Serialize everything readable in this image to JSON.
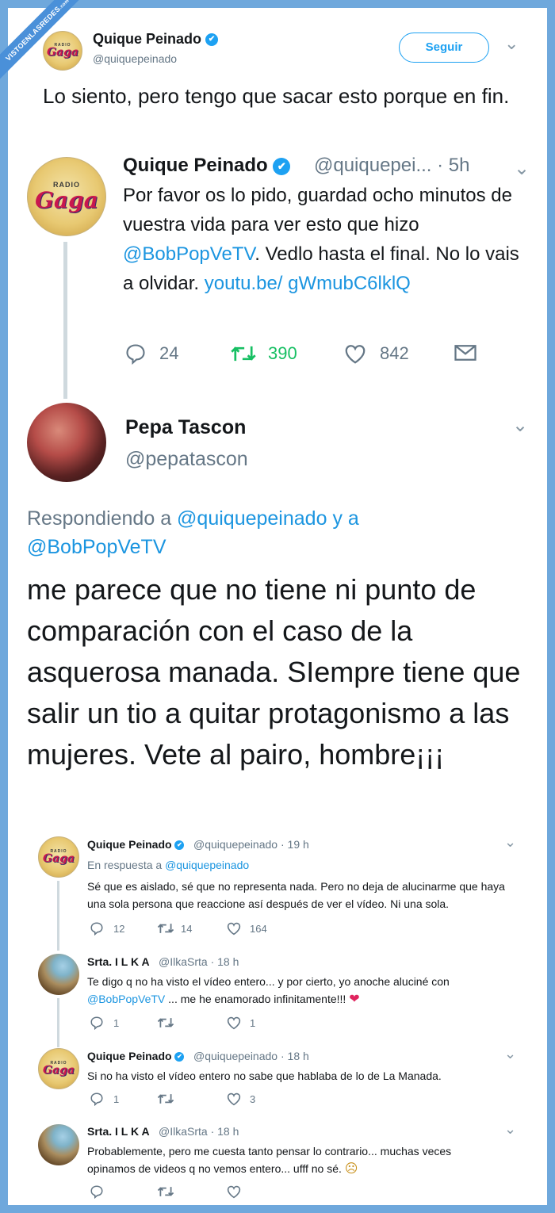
{
  "watermark": "VISTOENLASREDES",
  "watermark_suffix": ".com",
  "main_tweet": {
    "author": "Quique Peinado",
    "handle": "@quiquepeinado",
    "follow_label": "Seguir",
    "text": "Lo siento, pero tengo que sacar esto porque en fin."
  },
  "quoted_tweet": {
    "author": "Quique Peinado",
    "handle": "@quiquepei...",
    "time": "· 5h",
    "text_part1": "Por favor os lo pido, guardad ocho minutos de vuestra vida para ver esto que hizo ",
    "mention": "@BobPopVeTV",
    "text_part2": ". Vedlo hasta el final. No lo vais a olvidar. ",
    "link": "youtu.be/ gWmubC6lklQ",
    "replies": "24",
    "retweets": "390",
    "likes": "842"
  },
  "reply_tweet": {
    "author": "Pepa Tascon",
    "handle": "@pepatascon",
    "replying_prefix": "Respondiendo a",
    "replying_to_1": "@quiquepeinado",
    "replying_and": "y a",
    "replying_to_2": "@BobPopVeTV",
    "text": "me parece que no tiene ni punto de comparación con el caso de la asquerosa manada. SIempre tiene que salir un tio a quitar protagonismo a las mujeres. Vete al pairo, hombre¡¡¡"
  },
  "thread": [
    {
      "author": "Quique Peinado",
      "handle": "@quiquepeinado",
      "time": "· 19 h",
      "in_reply_prefix": "En respuesta a",
      "in_reply_to": "@quiquepeinado",
      "text": "Sé que es aislado, sé que no representa nada. Pero no deja de alucinarme que haya una sola persona que reaccione así después de ver el vídeo. Ni una sola.",
      "replies": "12",
      "retweets": "14",
      "likes": "164"
    },
    {
      "author": "Srta. I L K A",
      "handle": "@IlkaSrta",
      "time": "· 18 h",
      "text_part1": "Te digo q no ha visto el vídeo entero... y por cierto, yo anoche aluciné con",
      "mention": "@BobPopVeTV",
      "text_part2": " ... me he enamorado infinitamente!!!",
      "emoji": "❤",
      "replies": "1",
      "retweets": "",
      "likes": "1"
    },
    {
      "author": "Quique Peinado",
      "handle": "@quiquepeinado",
      "time": "· 18 h",
      "text": "Si no ha visto el vídeo entero no sabe que hablaba de lo de La Manada.",
      "replies": "1",
      "retweets": "",
      "likes": "3"
    },
    {
      "author": "Srta. I L K A",
      "handle": "@IlkaSrta",
      "time": "· 18 h",
      "text": "Probablemente, pero me cuesta tanto pensar lo contrario... muchas veces opinamos de videos q no vemos entero... ufff no sé.",
      "emoji": "☹",
      "replies": "",
      "retweets": "",
      "likes": ""
    }
  ],
  "icons": {
    "verified": "✔",
    "chevron": "⌄"
  },
  "colors": {
    "link": "#1b95e0",
    "retweet_green": "#17bf63",
    "frame": "#6fa8dc",
    "heart_red": "#e0245e"
  }
}
